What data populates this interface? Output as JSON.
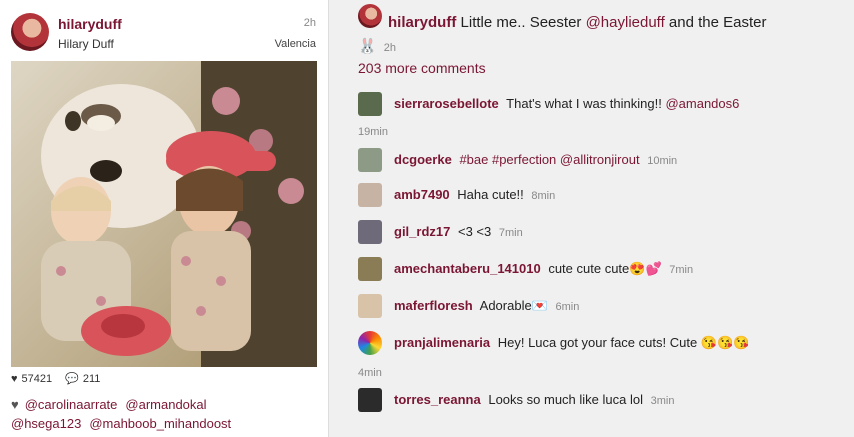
{
  "post": {
    "username": "hilaryduff",
    "fullname": "Hilary Duff",
    "time": "2h",
    "location": "Valencia",
    "likes_count": "57421",
    "comments_count": "211",
    "likers": [
      "@carolinaarrate",
      "@armandokal",
      "@hsega123",
      "@mahboob_mihandoost"
    ]
  },
  "caption": {
    "username": "hilaryduff",
    "text_before": "Little me.. Seester",
    "mention": "@haylieduff",
    "text_after": "and the Easter",
    "emoji": "🐰",
    "time": "2h"
  },
  "more_comments": "203 more comments",
  "comments": [
    {
      "user": "sierrarosebellote",
      "text": "That's what I was thinking!!",
      "mention": "@amandos6",
      "time": "19min"
    },
    {
      "user": "dcgoerke",
      "text": "",
      "mention": "#bae #perfection @allitronjirout",
      "time": "10min"
    },
    {
      "user": "amb7490",
      "text": "Haha cute!!",
      "mention": "",
      "time": "8min"
    },
    {
      "user": "gil_rdz17",
      "text": "<3 <3",
      "mention": "",
      "time": "7min"
    },
    {
      "user": "amechantaberu_141010",
      "text": "cute cute cute😍💕",
      "mention": "",
      "time": "7min"
    },
    {
      "user": "maferfloresh",
      "text": "Adorable💌",
      "mention": "",
      "time": "6min"
    },
    {
      "user": "pranjalimenaria",
      "text": "Hey! Luca got your face cuts! Cute 😘😘😘",
      "mention": "",
      "time": "4min"
    },
    {
      "user": "torres_reanna",
      "text": "Looks so much like luca lol",
      "mention": "",
      "time": "3min"
    }
  ],
  "colors": {
    "accent": "#7a1633",
    "text": "#222222",
    "muted": "#888888"
  },
  "icons": {
    "like": "heart-icon",
    "comment": "speech-bubble-icon",
    "caption_emoji": "rabbit-icon"
  }
}
